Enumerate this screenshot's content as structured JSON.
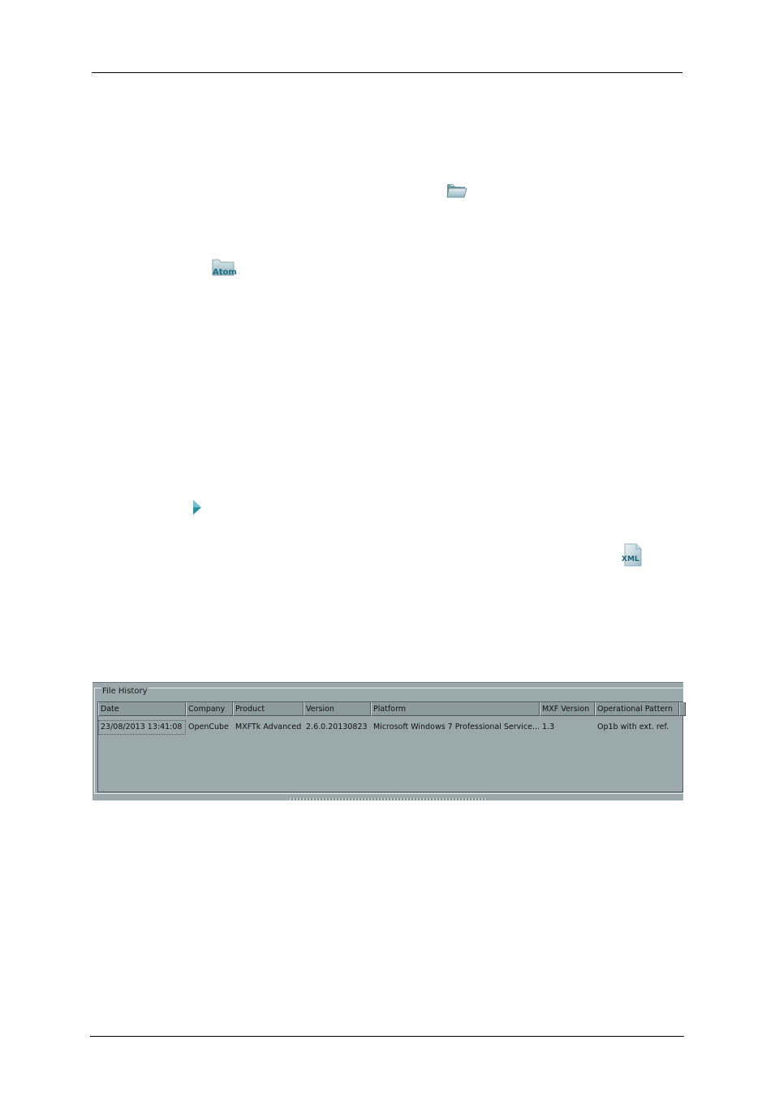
{
  "icons": {
    "open_folder": "open-folder-icon",
    "atom_folder": "atom-folder-icon",
    "atom_label": "Atom",
    "play": "play-arrow-icon",
    "xml": "xml-file-icon",
    "xml_label": "XML"
  },
  "file_history": {
    "title": "File History",
    "columns": [
      "Date",
      "Company",
      "Product",
      "Version",
      "Platform",
      "MXF Version",
      "Operational Pattern"
    ],
    "rows": [
      [
        "23/08/2013 13:41:08",
        "OpenCube",
        "MXFTk Advanced",
        "2.6.0.20130823",
        "Microsoft Windows 7 Professional Service...",
        "1.3",
        "Op1b with ext. ref."
      ]
    ]
  },
  "colors": {
    "panel_bg": "#9ca9ac",
    "icon_accent": "#2b8ea3"
  }
}
